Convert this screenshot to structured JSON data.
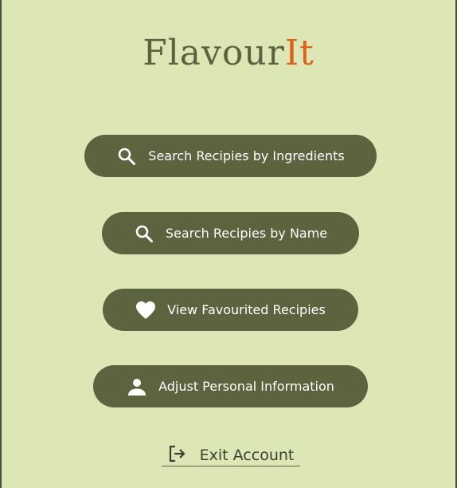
{
  "app": {
    "logo_main": "Flavour",
    "logo_accent": "It"
  },
  "menu": {
    "search_ingredients_label": "Search Recipies by Ingredients",
    "search_name_label": "Search Recipies by Name",
    "favourites_label": "View Favourited Recipies",
    "personal_info_label": "Adjust Personal Information"
  },
  "footer": {
    "exit_label": "Exit Account"
  },
  "icons": {
    "search_ingredients": "search-icon",
    "search_name": "search-icon",
    "favourites": "heart-icon",
    "personal_info": "person-icon",
    "exit": "logout-icon"
  },
  "colors": {
    "background": "#dde7b5",
    "button": "#5b633f",
    "logo_main": "#5a6240",
    "logo_accent": "#e0601e"
  }
}
